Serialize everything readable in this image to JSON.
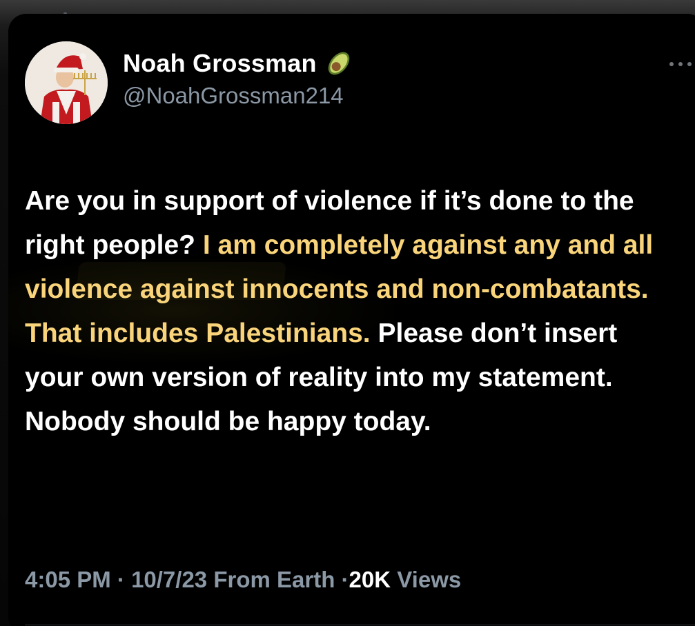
{
  "header": {
    "display_name": "Noah Grossman",
    "handle": "@NoahGrossman214",
    "verified_badge_icon": "avocado-emoji-icon",
    "more_icon": "more-horizontal-icon"
  },
  "tweet": {
    "text_part1": "Are you in support of violence if it’s done to the right people? ",
    "text_highlight": "I am completely against any and all violence against innocents and non-combatants. That includes Palestinians.",
    "text_part2": " Please don’t insert your own version of reality into my statement. Nobody should be happy today."
  },
  "meta": {
    "time": "4:05 PM",
    "separator": "·",
    "date": "10/7/23",
    "location": "From Earth",
    "views_count": "20K",
    "views_label": "Views"
  },
  "colors": {
    "background": "#000000",
    "text": "#ffffff",
    "secondary_text": "#8b98a5",
    "highlight_text": "#f9d47a"
  }
}
